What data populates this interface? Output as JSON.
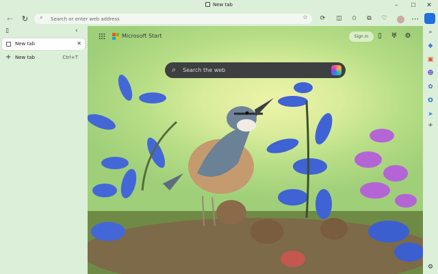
{
  "window": {
    "title": "New tab",
    "controls": {
      "minimize": "–",
      "maximize": "☐",
      "close": "✕"
    }
  },
  "toolbar": {
    "back": "←",
    "refresh": "↻",
    "address_placeholder": "Search or enter web address",
    "icons": [
      "split-screen-icon",
      "favorites-icon",
      "collections-icon",
      "browser-essentials-icon",
      "profile-icon",
      "more-icon"
    ]
  },
  "vertical_tabs": {
    "active_tab": {
      "label": "New tab"
    },
    "new_tab": {
      "label": "New tab",
      "shortcut": "Ctrl+T"
    }
  },
  "ntp": {
    "brand": "Microsoft Start",
    "signin": "Sign in",
    "search_placeholder": "Search the web"
  },
  "colors": {
    "accent": "#1f6fe0",
    "ms_red": "#f25022",
    "ms_green": "#7fba00",
    "ms_blue": "#00a4ef",
    "ms_yellow": "#ffb900"
  }
}
